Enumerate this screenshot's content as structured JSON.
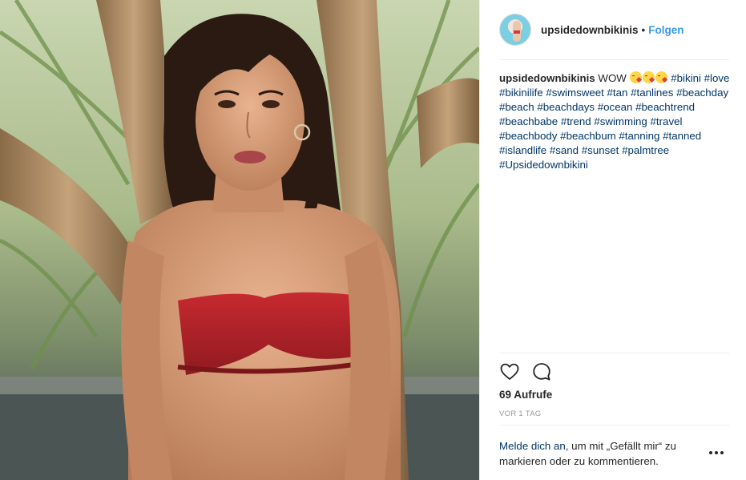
{
  "header": {
    "username": "upsidedownbikinis",
    "separator": "•",
    "follow_label": "Folgen"
  },
  "caption": {
    "username": "upsidedownbikinis",
    "text": "WOW",
    "emojis": [
      "face-blowing-kiss",
      "face-blowing-kiss",
      "face-blowing-kiss"
    ],
    "hashtags": [
      "#bikini",
      "#love",
      "#bikinilife",
      "#swimsweet",
      "#tan",
      "#tanlines",
      "#beachday",
      "#beach",
      "#beachdays",
      "#ocean",
      "#beachtrend",
      "#beachbabe",
      "#trend",
      "#swimming",
      "#travel",
      "#beachbody",
      "#beachbum",
      "#tanning",
      "#tanned",
      "#islandlife",
      "#sand",
      "#sunset",
      "#palmtree",
      "#Upsidedownbikini"
    ]
  },
  "actions": {
    "icons": [
      "heart-icon",
      "comment-icon"
    ]
  },
  "stats": {
    "views": "69 Aufrufe",
    "timestamp": "VOR 1 TAG"
  },
  "login_prompt": {
    "link_text": "Melde dich an",
    "rest_text": ", um mit „Gefällt mir“ zu markieren oder zu kommentieren."
  },
  "more_icon": "more-options-icon",
  "colors": {
    "link_blue": "#3897f0",
    "hashtag": "#003569",
    "text": "#262626",
    "muted": "#999999",
    "divider": "#efefef",
    "swimsuit_red": "#b8232a"
  }
}
